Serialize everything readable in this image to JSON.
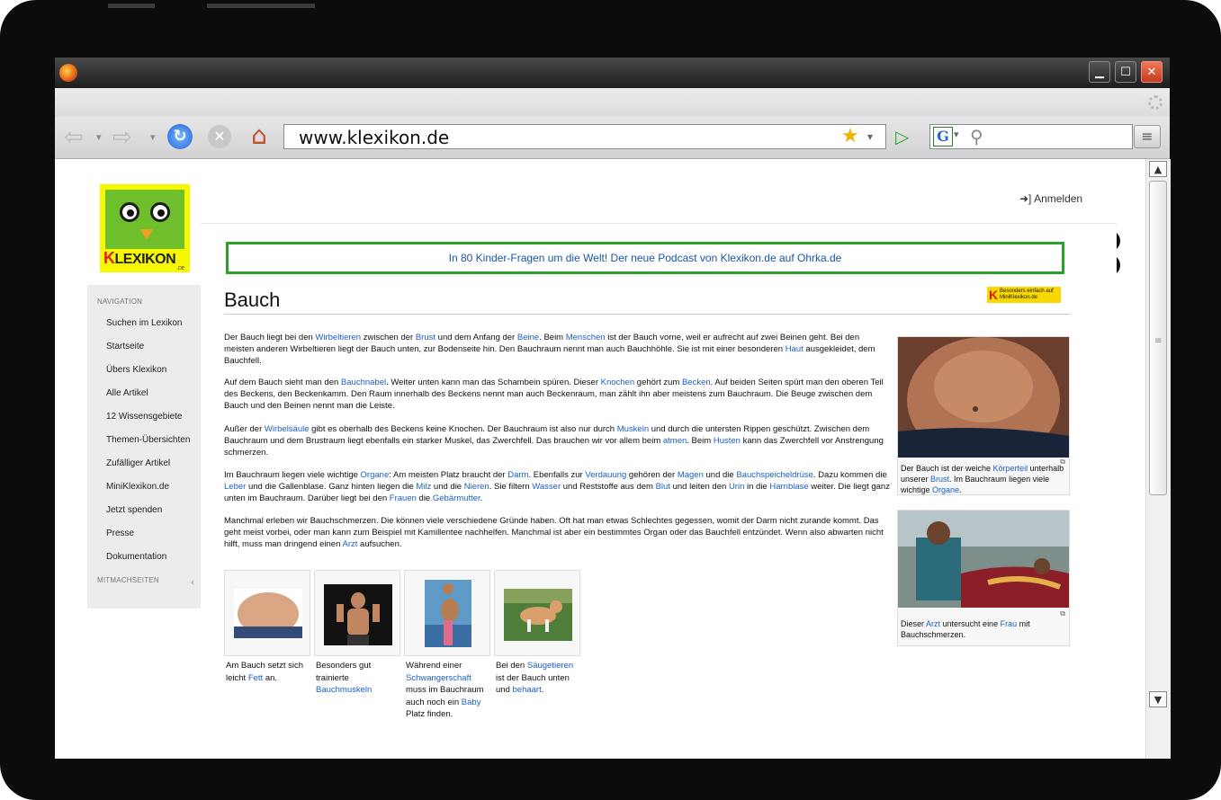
{
  "browser": {
    "url": "www.klexikon.de",
    "icons": [
      "firefox-logo",
      "back-arrow",
      "forward-arrow",
      "reload",
      "stop",
      "home",
      "star",
      "go-arrow",
      "google-search",
      "magnifier",
      "menu"
    ],
    "window_buttons": {
      "minimize": "▁",
      "maximize": "☐",
      "close": "✕"
    }
  },
  "site": {
    "logo_text_k": "K",
    "logo_text_rest": "LEXIKON",
    "logo_de": ".DE",
    "login_label": "Anmelden",
    "banner_text": "In 80 Kinder-Fragen um die Welt! Der neue Podcast von Klexikon.de auf Ohrka.de",
    "mini_badge": "Besonders einfach auf MiniKlexikon.de"
  },
  "sidebar": {
    "nav_heading": "NAVIGATION",
    "items": [
      "Suchen im Lexikon",
      "Startseite",
      "Übers Klexikon",
      "Alle Artikel",
      "12 Wissensgebiete",
      "Themen-Übersichten",
      "Zufälliger Artikel",
      "MiniKlexikon.de",
      "Jetzt spenden",
      "Presse",
      "Dokumentation"
    ],
    "mitmach_heading": "MITMACHSEITEN"
  },
  "article": {
    "title": "Bauch",
    "p1": {
      "segments": [
        {
          "t": "Der Bauch liegt bei den "
        },
        {
          "l": "Wirbeltieren"
        },
        {
          "t": " zwischen der "
        },
        {
          "l": "Brust"
        },
        {
          "t": " und dem Anfang der "
        },
        {
          "l": "Beine"
        },
        {
          "t": ". Beim "
        },
        {
          "l": "Menschen"
        },
        {
          "t": " ist der Bauch vorne, weil er aufrecht auf zwei Beinen geht. Bei den meisten anderen Wirbeltieren liegt der Bauch unten, zur Bodenseite hin. Den Bauchraum nennt man auch Bauchhöhle. Sie ist mit einer besonderen "
        },
        {
          "l": "Haut"
        },
        {
          "t": " ausgekleidet, dem Bauchfell."
        }
      ]
    },
    "p2": {
      "segments": [
        {
          "t": "Auf dem Bauch sieht man den "
        },
        {
          "l": "Bauchnabel"
        },
        {
          "t": ". Weiter unten kann man das Schambein spüren. Dieser "
        },
        {
          "l": "Knochen"
        },
        {
          "t": " gehört zum "
        },
        {
          "l": "Becken"
        },
        {
          "t": ". Auf beiden Seiten spürt man den oberen Teil des Beckens, den Beckenkamm. Den Raum innerhalb des Beckens nennt man auch Beckenraum, man zählt ihn aber meistens zum Bauchraum. Die Beuge zwischen dem Bauch und den Beinen nennt man die Leiste."
        }
      ]
    },
    "p3": {
      "segments": [
        {
          "t": "Außer der "
        },
        {
          "l": "Wirbelsäule"
        },
        {
          "t": " gibt es oberhalb des Beckens keine Knochen. Der Bauchraum ist also nur durch "
        },
        {
          "l": "Muskeln"
        },
        {
          "t": " und durch die untersten Rippen geschützt. Zwischen dem Bauchraum und dem Brustraum liegt ebenfalls ein starker Muskel, das Zwerchfell. Das brauchen wir vor allem beim "
        },
        {
          "l": "atmen"
        },
        {
          "t": ". Beim "
        },
        {
          "l": "Husten"
        },
        {
          "t": " kann das Zwerchfell vor Anstrengung schmerzen."
        }
      ]
    },
    "p4": {
      "segments": [
        {
          "t": "Im Bauchraum liegen viele wichtige "
        },
        {
          "l": "Organe"
        },
        {
          "t": ": Am meisten Platz braucht der "
        },
        {
          "l": "Darm"
        },
        {
          "t": ". Ebenfalls zur "
        },
        {
          "l": "Verdauung"
        },
        {
          "t": " gehören der "
        },
        {
          "l": "Magen"
        },
        {
          "t": " und die "
        },
        {
          "l": "Bauchspeicheldrüse"
        },
        {
          "t": ". Dazu kommen die "
        },
        {
          "l": "Leber"
        },
        {
          "t": " und die Gallenblase. Ganz hinten liegen die "
        },
        {
          "l": "Milz"
        },
        {
          "t": " und die "
        },
        {
          "l": "Nieren"
        },
        {
          "t": ". Sie filtern "
        },
        {
          "l": "Wasser"
        },
        {
          "t": " und Reststoffe aus dem "
        },
        {
          "l": "Blut"
        },
        {
          "t": " und leiten den "
        },
        {
          "l": "Urin"
        },
        {
          "t": " in die "
        },
        {
          "l": "Harnblase"
        },
        {
          "t": " weiter. Die liegt ganz unten im Bauchraum. Darüber liegt bei den "
        },
        {
          "l": "Frauen"
        },
        {
          "t": " die "
        },
        {
          "l": "Gebärmutter"
        },
        {
          "t": "."
        }
      ]
    },
    "p5": {
      "segments": [
        {
          "t": "Manchmal erleben wir Bauchschmerzen. Die können viele verschiedene Gründe haben. Oft hat man etwas Schlechtes gegessen, womit der Darm nicht zurande kommt. Das geht meist vorbei, oder man kann zum Beispiel mit Kamillentee nachhelfen. Manchmal ist aber ein bestimmtes Organ oder das Bauchfell entzündet. Wenn also abwarten nicht hilft, muss man dringend einen "
        },
        {
          "l": "Arzt"
        },
        {
          "t": " aufsuchen."
        }
      ]
    },
    "fig1_caption": {
      "segments": [
        {
          "t": "Der Bauch ist der weiche "
        },
        {
          "l": "Körperteil"
        },
        {
          "t": " unterhalb unserer "
        },
        {
          "l": "Brust"
        },
        {
          "t": ". Im Bauchraum liegen viele wichtige "
        },
        {
          "l": "Organe"
        },
        {
          "t": "."
        }
      ]
    },
    "fig2_caption": {
      "segments": [
        {
          "t": "Dieser "
        },
        {
          "l": "Arzt"
        },
        {
          "t": " untersucht eine "
        },
        {
          "l": "Frau"
        },
        {
          "t": " mit Bauchschmerzen."
        }
      ]
    },
    "gallery": [
      {
        "segments": [
          {
            "t": "Am Bauch setzt sich leicht "
          },
          {
            "l": "Fett"
          },
          {
            "t": " an."
          }
        ]
      },
      {
        "segments": [
          {
            "t": "Besonders gut trainierte "
          },
          {
            "l": "Bauchmuskeln"
          }
        ]
      },
      {
        "segments": [
          {
            "t": "Während einer "
          },
          {
            "l": "Schwangerschaft"
          },
          {
            "t": " muss im Bauchraum auch noch ein "
          },
          {
            "l": "Baby"
          },
          {
            "t": " Platz finden."
          }
        ]
      },
      {
        "segments": [
          {
            "t": "Bei den "
          },
          {
            "l": "Säugetieren"
          },
          {
            "t": " ist der Bauch unten und "
          },
          {
            "l": "behaart"
          },
          {
            "t": "."
          }
        ]
      }
    ]
  },
  "colors": {
    "link": "#1a5ec8",
    "banner_border": "#2aa22a",
    "logo_yellow": "#f8f800",
    "logo_green": "#6fbe2c"
  }
}
